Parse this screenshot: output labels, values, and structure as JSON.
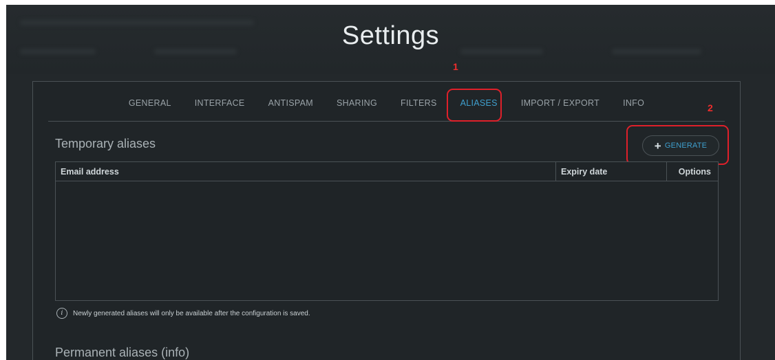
{
  "page": {
    "title": "Settings"
  },
  "tabs": [
    {
      "label": "GENERAL",
      "active": false
    },
    {
      "label": "INTERFACE",
      "active": false
    },
    {
      "label": "ANTISPAM",
      "active": false
    },
    {
      "label": "SHARING",
      "active": false
    },
    {
      "label": "FILTERS",
      "active": false
    },
    {
      "label": "ALIASES",
      "active": true
    },
    {
      "label": "IMPORT / EXPORT",
      "active": false
    },
    {
      "label": "INFO",
      "active": false
    }
  ],
  "annotations": {
    "marker_1": "1",
    "marker_2": "2",
    "color": "#e0202a"
  },
  "temporary_aliases": {
    "title": "Temporary aliases",
    "generate_button": {
      "icon": "plus-icon",
      "icon_glyph": "+",
      "label": "GENERATE"
    },
    "table": {
      "columns": [
        "Email address",
        "Expiry date",
        "Options"
      ],
      "rows": []
    },
    "note": {
      "icon": "info-icon",
      "icon_glyph": "i",
      "text": "Newly generated aliases will only be available after the configuration is saved."
    }
  },
  "permanent_aliases": {
    "title": "Permanent aliases (info)"
  },
  "colors": {
    "background": "#23282b",
    "accent": "#3fa0cf",
    "border": "#4b5256",
    "annotation": "#e0202a"
  }
}
